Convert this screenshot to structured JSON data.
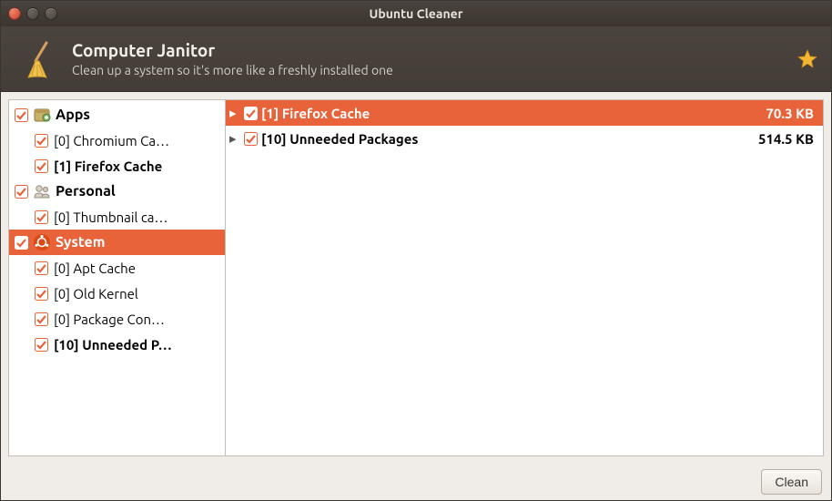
{
  "window": {
    "title": "Ubuntu Cleaner"
  },
  "header": {
    "title": "Computer Janitor",
    "subtitle": "Clean up a system so it's more like a freshly installed one"
  },
  "colors": {
    "accent": "#e8633a"
  },
  "sidebar": {
    "categories": [
      {
        "label": "Apps",
        "icon": "apps",
        "checked": true,
        "selected": false,
        "items": [
          {
            "count": 0,
            "label": "Chromium Ca…",
            "checked": true,
            "bold": false
          },
          {
            "count": 1,
            "label": "Firefox Cache",
            "checked": true,
            "bold": true
          }
        ]
      },
      {
        "label": "Personal",
        "icon": "personal",
        "checked": true,
        "selected": false,
        "items": [
          {
            "count": 0,
            "label": "Thumbnail ca…",
            "checked": true,
            "bold": false
          }
        ]
      },
      {
        "label": "System",
        "icon": "system",
        "checked": true,
        "selected": true,
        "items": [
          {
            "count": 0,
            "label": "Apt Cache",
            "checked": true,
            "bold": false
          },
          {
            "count": 0,
            "label": "Old Kernel",
            "checked": true,
            "bold": false
          },
          {
            "count": 0,
            "label": "Package Con…",
            "checked": true,
            "bold": false
          },
          {
            "count": 10,
            "label": "Unneeded P…",
            "checked": true,
            "bold": true
          }
        ]
      }
    ]
  },
  "content": {
    "rows": [
      {
        "count": 1,
        "label": "Firefox Cache",
        "size": "70.3 KB",
        "checked": true,
        "selected": true
      },
      {
        "count": 10,
        "label": "Unneeded Packages",
        "size": "514.5 KB",
        "checked": true,
        "selected": false
      }
    ]
  },
  "buttons": {
    "clean": "Clean"
  }
}
